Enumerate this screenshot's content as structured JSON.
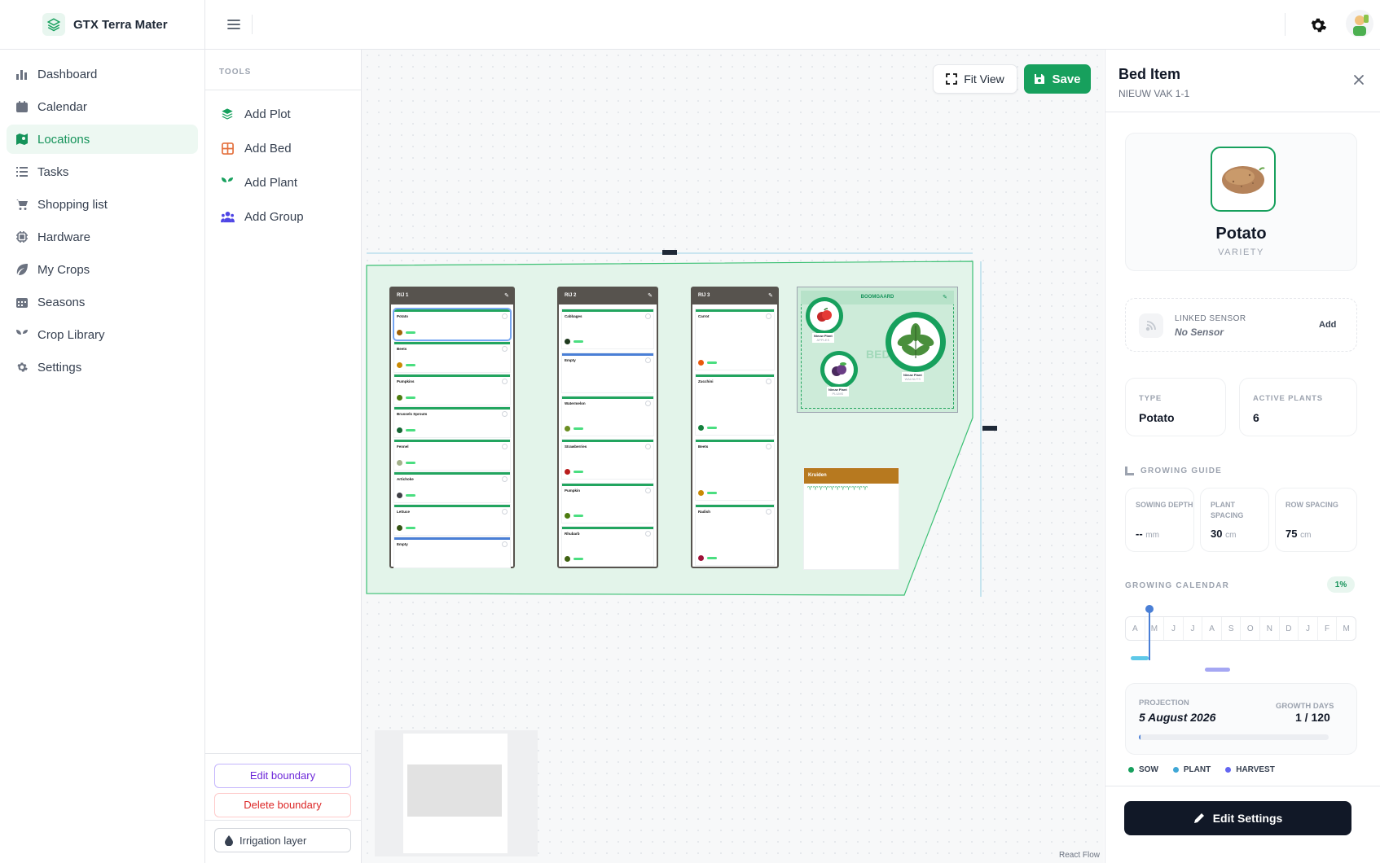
{
  "brand": {
    "name": "GTX Terra Mater"
  },
  "sidebar": {
    "items": [
      {
        "label": "Dashboard",
        "icon": "bar-chart-icon"
      },
      {
        "label": "Calendar",
        "icon": "calendar-icon"
      },
      {
        "label": "Locations",
        "icon": "map-pin-icon",
        "active": true
      },
      {
        "label": "Tasks",
        "icon": "list-icon"
      },
      {
        "label": "Shopping list",
        "icon": "cart-icon"
      },
      {
        "label": "Hardware",
        "icon": "chip-icon"
      },
      {
        "label": "My Crops",
        "icon": "leaf-icon"
      },
      {
        "label": "Seasons",
        "icon": "grid-calendar-icon"
      },
      {
        "label": "Crop Library",
        "icon": "sprout-icon"
      },
      {
        "label": "Settings",
        "icon": "gear-icon"
      }
    ]
  },
  "tools": {
    "heading": "TOOLS",
    "items": [
      {
        "label": "Add Plot",
        "icon": "layers-icon",
        "color": "#17a05d"
      },
      {
        "label": "Add Bed",
        "icon": "grid-icon",
        "color": "#e4703d"
      },
      {
        "label": "Add Plant",
        "icon": "sprout-icon",
        "color": "#17a05d"
      },
      {
        "label": "Add Group",
        "icon": "users-icon",
        "color": "#4f46e5"
      }
    ],
    "edit_boundary": "Edit boundary",
    "delete_boundary": "Delete boundary",
    "irrigation": "Irrigation layer"
  },
  "canvas": {
    "fit_view": "Fit View",
    "save": "Save",
    "attribution": "React Flow",
    "beds": [
      {
        "name": "RIJ 1",
        "slots": [
          "Potato",
          "Beets",
          "Pumpkins",
          "Brussels Sprouts",
          "Fennel",
          "Artichoke",
          "Lettuce",
          "Empty"
        ]
      },
      {
        "name": "RIJ 2",
        "slots": [
          "Cabbages",
          "Empty",
          "Watermelon",
          "Strawberries",
          "Pumpkin",
          "Rhubarb"
        ]
      },
      {
        "name": "RIJ 3",
        "slots": [
          "Carrot",
          "Zucchini",
          "Beets",
          "Radish"
        ]
      }
    ],
    "orchard": {
      "name": "BOOMGAARD",
      "plant_label": "Nieuw Plant",
      "plant_types": [
        "APPLES",
        "WALNUTS",
        "PLUMS"
      ],
      "watermark": "BED"
    },
    "herbs": {
      "name": "Kruiden"
    }
  },
  "panel": {
    "title": "Bed Item",
    "subtitle": "NIEUW VAK 1-1",
    "crop_name": "Potato",
    "crop_kind": "VARIETY",
    "sensor_label": "LINKED SENSOR",
    "sensor_value": "No Sensor",
    "sensor_add": "Add",
    "type_label": "TYPE",
    "type_value": "Potato",
    "active_label": "ACTIVE PLANTS",
    "active_value": "6",
    "guide_title": "GROWING GUIDE",
    "sowing_label": "SOWING DEPTH",
    "sowing_value": "--",
    "sowing_unit": "mm",
    "plant_spacing_label": "PLANT SPACING",
    "plant_spacing_value": "30",
    "plant_spacing_unit": "cm",
    "row_spacing_label": "ROW SPACING",
    "row_spacing_value": "75",
    "row_spacing_unit": "cm",
    "calendar_title": "GROWING CALENDAR",
    "calendar_pct": "1%",
    "months": [
      "A",
      "M",
      "J",
      "J",
      "A",
      "S",
      "O",
      "N",
      "D",
      "J",
      "F",
      "M"
    ],
    "projection_label": "PROJECTION",
    "projection_value": "5 August 2026",
    "growth_label": "GROWTH DAYS",
    "growth_value": "1 / 120",
    "growth_progress": 0.01,
    "legend": [
      {
        "label": "SOW",
        "color": "#17a05d"
      },
      {
        "label": "PLANT",
        "color": "#3fa7d6"
      },
      {
        "label": "HARVEST",
        "color": "#6366f1"
      }
    ],
    "edit_settings": "Edit Settings"
  }
}
